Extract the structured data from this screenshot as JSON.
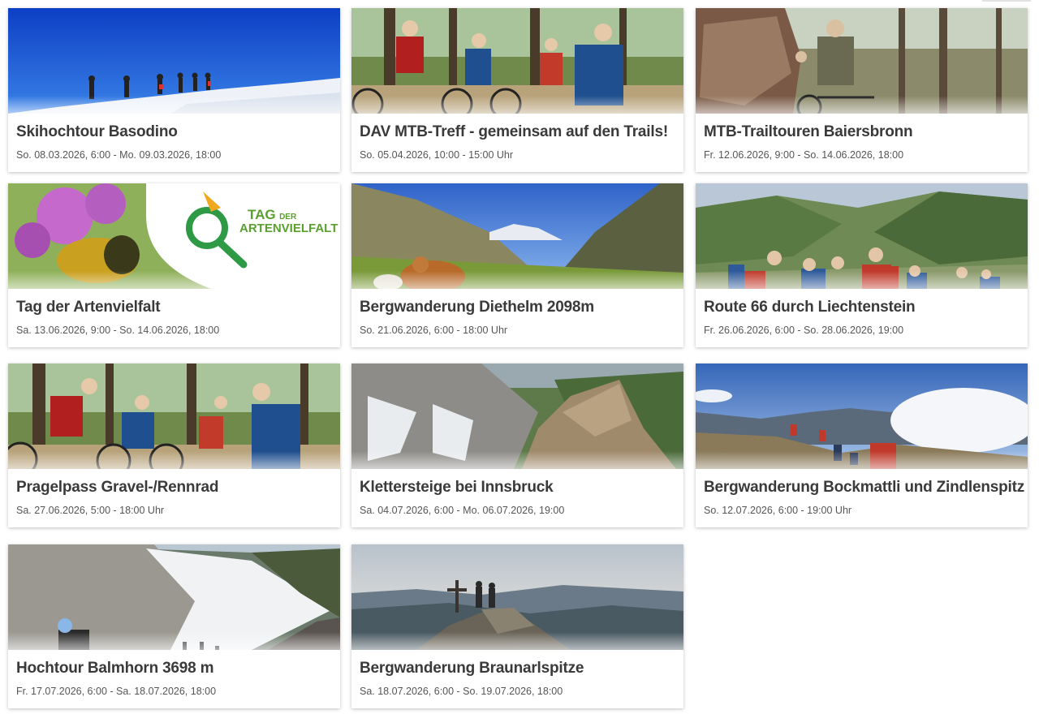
{
  "events": [
    {
      "title": "Skihochtour Basodino",
      "date": "So. 08.03.2026, 6:00 - Mo. 09.03.2026, 18:00",
      "image": "ski-tour-photo"
    },
    {
      "title": "DAV MTB-Treff - gemeinsam auf den Trails!",
      "date": "So. 05.04.2026, 10:00 - 15:00 Uhr",
      "image": "mtb-group-photo"
    },
    {
      "title": "MTB-Trailtouren Baiersbronn",
      "date": "Fr. 12.06.2026, 9:00 - So. 14.06.2026, 18:00",
      "image": "mtb-forest-photo"
    },
    {
      "title": "Tag der Artenvielfalt",
      "date": "Sa. 13.06.2026, 9:00 - So. 14.06.2026, 18:00",
      "image": "biodiversity-banner",
      "logo_text": [
        "TAG",
        "DER",
        "ARTENVIELFALT"
      ]
    },
    {
      "title": "Bergwanderung Diethelm 2098m",
      "date": "So. 21.06.2026, 6:00 - 18:00 Uhr",
      "image": "alpine-cow-photo"
    },
    {
      "title": "Route 66 durch Liechtenstein",
      "date": "Fr. 26.06.2026, 6:00 - So. 28.06.2026, 19:00",
      "image": "hiking-group-photo"
    },
    {
      "title": "Pragelpass Gravel-/Rennrad",
      "date": "Sa. 27.06.2026, 5:00 - 18:00 Uhr",
      "image": "bike-group-photo"
    },
    {
      "title": "Klettersteige bei Innsbruck",
      "date": "Sa. 04.07.2026, 6:00 - Mo. 06.07.2026, 19:00",
      "image": "rock-ridge-photo"
    },
    {
      "title": "Bergwanderung Bockmattli und Zindlenspitz",
      "date": "So. 12.07.2026, 6:00 - 19:00 Uhr",
      "image": "mountain-hikers-photo"
    },
    {
      "title": "Hochtour Balmhorn 3698 m",
      "date": "Fr. 17.07.2026, 6:00 - Sa. 18.07.2026, 18:00",
      "image": "glacier-climb-photo"
    },
    {
      "title": "Bergwanderung Braunarlspitze",
      "date": "Sa. 18.07.2026, 6:00 - So. 19.07.2026, 18:00",
      "image": "summit-cross-photo"
    }
  ]
}
